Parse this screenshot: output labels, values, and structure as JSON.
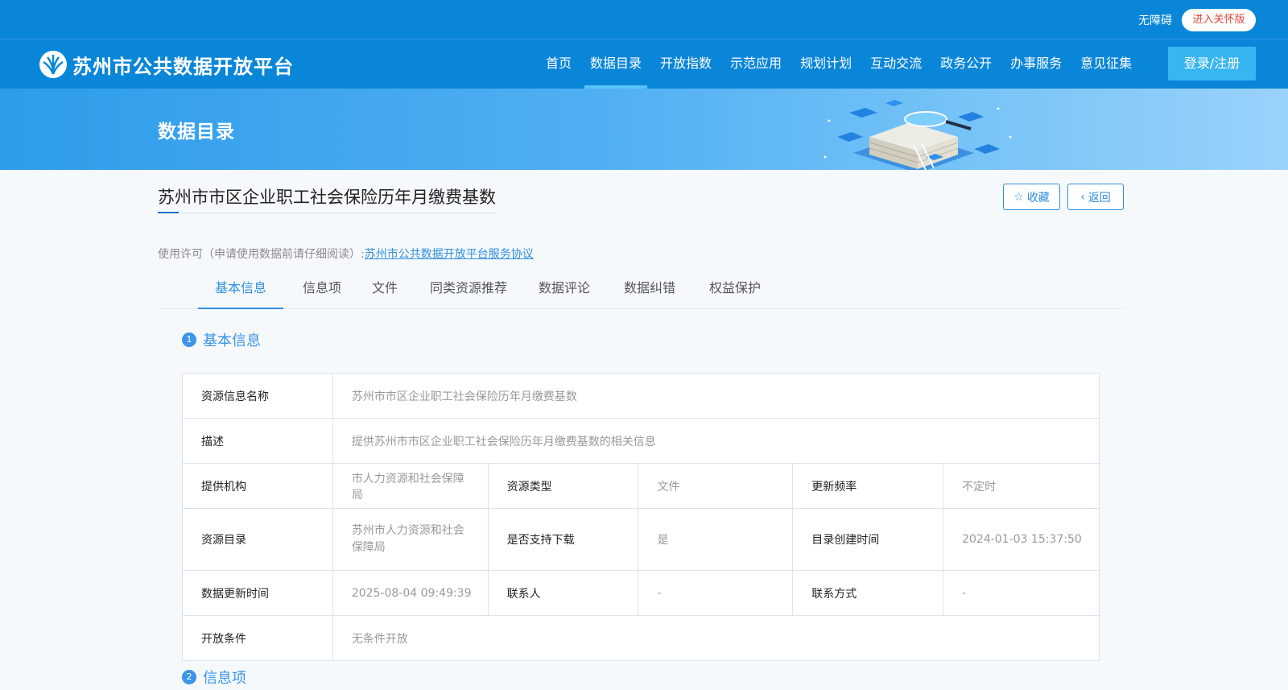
{
  "topbar": {
    "accessibility": "无障碍",
    "care_mode": "进入关怀版"
  },
  "header": {
    "logo_text": "苏州市公共数据开放平台",
    "nav": [
      "首页",
      "数据目录",
      "开放指数",
      "示范应用",
      "规划计划",
      "互动交流",
      "政务公开",
      "办事服务",
      "意见征集"
    ],
    "active_nav": "数据目录",
    "login": "登录/注册"
  },
  "banner": {
    "title": "数据目录"
  },
  "dataset": {
    "title": "苏州市市区企业职工社会保险历年月缴费基数",
    "favorite": "收藏",
    "back": "返回",
    "license_label": "使用许可（申请使用数据前请仔细阅读）:",
    "license_link": "苏州市公共数据开放平台服务协议"
  },
  "tabs": [
    "基本信息",
    "信息项",
    "文件",
    "同类资源推荐",
    "数据评论",
    "数据纠错",
    "权益保护"
  ],
  "section1": {
    "num": "1",
    "title": "基本信息"
  },
  "basic_info": {
    "name_k": "资源信息名称",
    "name_v": "苏州市市区企业职工社会保险历年月缴费基数",
    "desc_k": "描述",
    "desc_v": "提供苏州市市区企业职工社会保险历年月缴费基数的相关信息",
    "org_k": "提供机构",
    "org_v": "市人力资源和社会保障局",
    "type_k": "资源类型",
    "type_v": "文件",
    "freq_k": "更新频率",
    "freq_v": "不定时",
    "catalog_k": "资源目录",
    "catalog_v": "苏州市人力资源和社会保障局",
    "download_k": "是否支持下载",
    "download_v": "是",
    "created_k": "目录创建时间",
    "created_v": "2024-01-03 15:37:50",
    "updated_k": "数据更新时间",
    "updated_v": "2025-08-04 09:49:39",
    "contact_k": "联系人",
    "contact_v": "-",
    "phone_k": "联系方式",
    "phone_v": "-",
    "open_k": "开放条件",
    "open_v": "无条件开放"
  },
  "section2": {
    "num": "2",
    "title": "信息项"
  }
}
